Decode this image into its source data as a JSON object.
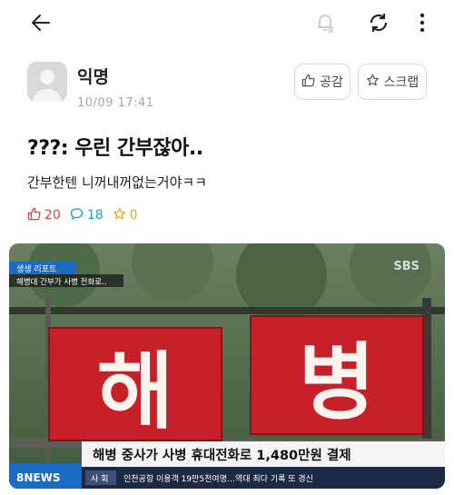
{
  "toolbar": {
    "back_icon": "arrow-left-icon",
    "bell_icon": "bell-off-icon",
    "refresh_icon": "refresh-icon",
    "more_icon": "more-vertical-icon"
  },
  "post": {
    "author": "익명",
    "date": "10/09 17:41",
    "like_button_label": "공감",
    "scrap_button_label": "스크랩",
    "title": "???: 우린 간부잖아..",
    "body": "간부한텐 니꺼내꺼없는거야ㅋㅋ",
    "likes": "20",
    "comments": "18",
    "scraps": "0"
  },
  "image": {
    "badge": "생생 리포트",
    "sub_caption": "해병대 간부가 사병 전화로..",
    "channel": "SBS",
    "sign_left": "해",
    "sign_right": "병",
    "headline": "해병 중사가 사병 휴대전화로 1,480만원 결제",
    "news_logo": "8NEWS",
    "section": "사 회",
    "ticker": "인천공항 이용객 19만5천여명…역대 최다 기록 또 경신"
  },
  "colors": {
    "like": "#e0413a",
    "comment": "#16a2c5",
    "scrap": "#e4aa13",
    "sign": "#c8202b",
    "news_blue": "#1a6dc2"
  }
}
